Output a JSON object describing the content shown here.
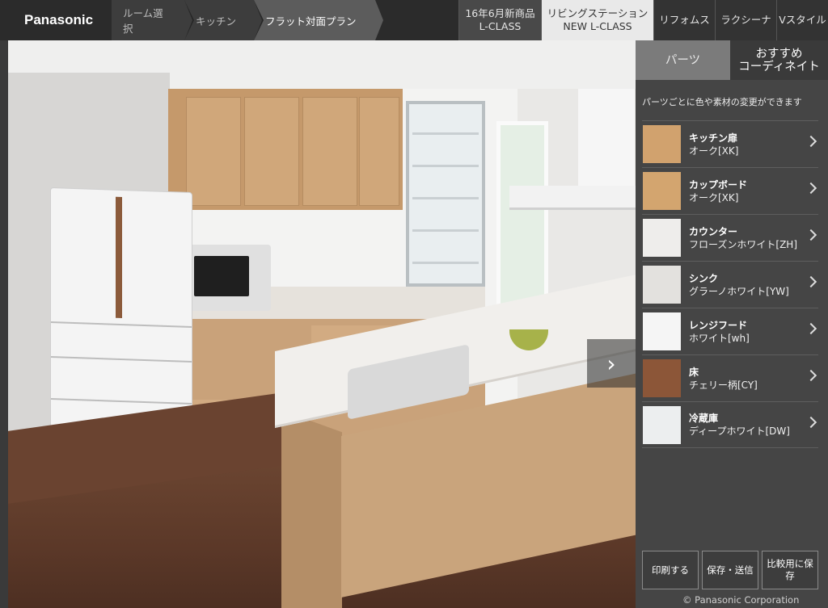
{
  "header": {
    "logo": "Panasonic",
    "breadcrumbs": [
      "ルーム選択",
      "キッチン",
      "フラット対面プラン"
    ],
    "tabs": [
      {
        "line1": "16年6月新商品",
        "line2": "L-CLASS"
      },
      {
        "line1": "リビングステーション",
        "line2": "NEW L-CLASS"
      },
      {
        "line1": "リフォムス",
        "line2": ""
      },
      {
        "line1": "ラクシーナ",
        "line2": ""
      },
      {
        "line1": "Vスタイル",
        "line2": ""
      }
    ]
  },
  "scene": {
    "next_icon": "chevron-right-icon"
  },
  "panel": {
    "tab_parts": "パーツ",
    "tab_coord": "おすすめ\nコーディネイト",
    "note": "パーツごとに色や素材の変更ができます",
    "items": [
      {
        "name": "キッチン扉",
        "value": "オーク[XK]",
        "color": "#d1a26e"
      },
      {
        "name": "カップボード",
        "value": "オーク[XK]",
        "color": "#d3a56f"
      },
      {
        "name": "カウンター",
        "value": "フローズンホワイト[ZH]",
        "color": "#eeedeb"
      },
      {
        "name": "シンク",
        "value": "グラーノホワイト[YW]",
        "color": "#e3e1de"
      },
      {
        "name": "レンジフード",
        "value": "ホワイト[wh]",
        "color": "#f5f5f5"
      },
      {
        "name": "床",
        "value": "チェリー柄[CY]",
        "color": "#8c5638"
      },
      {
        "name": "冷蔵庫",
        "value": "ディープホワイト[DW]",
        "color": "#eceeef"
      }
    ],
    "buttons": [
      "印刷する",
      "保存・送信",
      "比較用に保存"
    ],
    "copyright": "© Panasonic Corporation"
  }
}
